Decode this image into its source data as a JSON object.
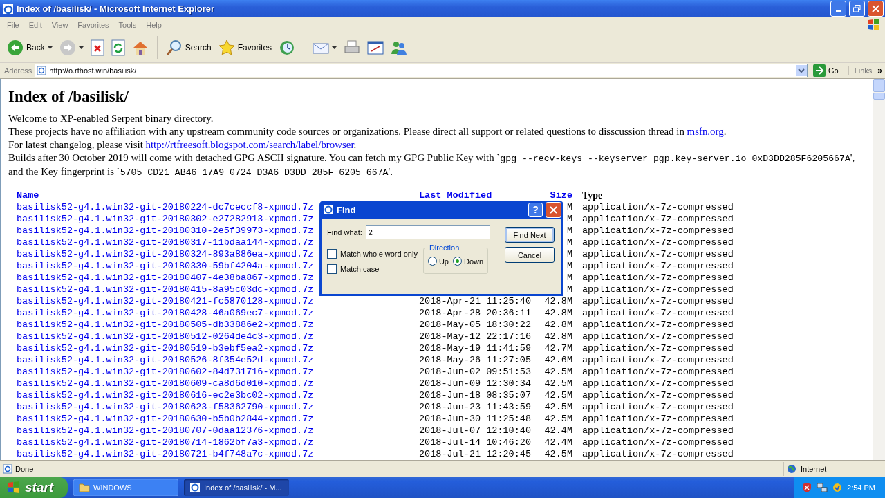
{
  "window": {
    "title": "Index of /basilisk/ - Microsoft Internet Explorer"
  },
  "menu": [
    "File",
    "Edit",
    "View",
    "Favorites",
    "Tools",
    "Help"
  ],
  "toolbar": [
    {
      "kind": "back",
      "label": "Back"
    },
    {
      "kind": "forward"
    },
    {
      "kind": "stop"
    },
    {
      "kind": "refresh"
    },
    {
      "kind": "home"
    },
    {
      "kind": "search",
      "label": "Search"
    },
    {
      "kind": "favorites",
      "label": "Favorites"
    },
    {
      "kind": "history"
    },
    {
      "kind": "mail"
    },
    {
      "kind": "print"
    },
    {
      "kind": "edit"
    },
    {
      "kind": "messenger"
    }
  ],
  "address": {
    "label": "Address",
    "value": "http://o.rthost.win/basilisk/",
    "go": "Go",
    "links": "Links",
    "more": "»"
  },
  "page": {
    "heading": "Index of /basilisk/",
    "paragraphs": [
      [
        {
          "kind": "text",
          "text": "Welcome to XP-enabled Serpent binary directory."
        }
      ],
      [
        {
          "kind": "text",
          "text": "These projects have no affiliation with any upstream community code sources or organizations. Please direct all support or related questions to disscussion thread in "
        },
        {
          "kind": "link",
          "text": "msfn.org"
        },
        {
          "kind": "text",
          "text": "."
        }
      ],
      [
        {
          "kind": "text",
          "text": "For latest changelog, please visit "
        },
        {
          "kind": "link",
          "text": "http://rtfreesoft.blogspot.com/search/label/browser"
        },
        {
          "kind": "text",
          "text": "."
        }
      ],
      [
        {
          "kind": "text",
          "text": "Builds after 30 October 2019 will come with detached GPG ASCII signature. You can fetch my GPG Public Key with `"
        },
        {
          "kind": "code",
          "text": "gpg --recv-keys --keyserver pgp.key-server.io 0xD3DD285F6205667A"
        },
        {
          "kind": "text",
          "text": "', and the Key fingerprint is `"
        },
        {
          "kind": "code",
          "text": "5705 CD21 AB46 17A9 0724 D3A6 D3DD 285F 6205 667A"
        },
        {
          "kind": "text",
          "text": "'."
        }
      ]
    ],
    "table": {
      "columns": [
        {
          "label": "Name",
          "kind": "link"
        },
        {
          "label": "Last Modified",
          "kind": "link"
        },
        {
          "label": "Size",
          "kind": "link"
        },
        {
          "label": "Type",
          "kind": "plain"
        }
      ],
      "rows": [
        {
          "name": "basilisk52-g4.1.win32-git-20180224-dc7ceccf8-xpmod.7z",
          "size": "M",
          "type": "application/x-7z-compressed"
        },
        {
          "name": "basilisk52-g4.1.win32-git-20180302-e27282913-xpmod.7z",
          "size": "M",
          "type": "application/x-7z-compressed"
        },
        {
          "name": "basilisk52-g4.1.win32-git-20180310-2e5f39973-xpmod.7z",
          "size": "M",
          "type": "application/x-7z-compressed"
        },
        {
          "name": "basilisk52-g4.1.win32-git-20180317-11bdaa144-xpmod.7z",
          "size": "M",
          "type": "application/x-7z-compressed"
        },
        {
          "name": "basilisk52-g4.1.win32-git-20180324-893a886ea-xpmod.7z",
          "size": "M",
          "type": "application/x-7z-compressed"
        },
        {
          "name": "basilisk52-g4.1.win32-git-20180330-59bf4204a-xpmod.7z",
          "size": "M",
          "type": "application/x-7z-compressed"
        },
        {
          "name": "basilisk52-g4.1.win32-git-20180407-4e38ba867-xpmod.7z",
          "size": "M",
          "type": "application/x-7z-compressed"
        },
        {
          "name": "basilisk52-g4.1.win32-git-20180415-8a95c03dc-xpmod.7z",
          "size": "M",
          "type": "application/x-7z-compressed"
        },
        {
          "name": "basilisk52-g4.1.win32-git-20180421-fc5870128-xpmod.7z",
          "modified": "2018-Apr-21 11:25:40",
          "size": "42.8M",
          "type": "application/x-7z-compressed"
        },
        {
          "name": "basilisk52-g4.1.win32-git-20180428-46a069ec7-xpmod.7z",
          "modified": "2018-Apr-28 20:36:11",
          "size": "42.8M",
          "type": "application/x-7z-compressed"
        },
        {
          "name": "basilisk52-g4.1.win32-git-20180505-db33886e2-xpmod.7z",
          "modified": "2018-May-05 18:30:22",
          "size": "42.8M",
          "type": "application/x-7z-compressed"
        },
        {
          "name": "basilisk52-g4.1.win32-git-20180512-0264de4c3-xpmod.7z",
          "modified": "2018-May-12 22:17:16",
          "size": "42.8M",
          "type": "application/x-7z-compressed"
        },
        {
          "name": "basilisk52-g4.1.win32-git-20180519-b3ebf5ea2-xpmod.7z",
          "modified": "2018-May-19 11:41:59",
          "size": "42.7M",
          "type": "application/x-7z-compressed"
        },
        {
          "name": "basilisk52-g4.1.win32-git-20180526-8f354e52d-xpmod.7z",
          "modified": "2018-May-26 11:27:05",
          "size": "42.6M",
          "type": "application/x-7z-compressed"
        },
        {
          "name": "basilisk52-g4.1.win32-git-20180602-84d731716-xpmod.7z",
          "modified": "2018-Jun-02 09:51:53",
          "size": "42.5M",
          "type": "application/x-7z-compressed"
        },
        {
          "name": "basilisk52-g4.1.win32-git-20180609-ca8d6d010-xpmod.7z",
          "modified": "2018-Jun-09 12:30:34",
          "size": "42.5M",
          "type": "application/x-7z-compressed"
        },
        {
          "name": "basilisk52-g4.1.win32-git-20180616-ec2e3bc02-xpmod.7z",
          "modified": "2018-Jun-18 08:35:07",
          "size": "42.5M",
          "type": "application/x-7z-compressed"
        },
        {
          "name": "basilisk52-g4.1.win32-git-20180623-f58362790-xpmod.7z",
          "modified": "2018-Jun-23 11:43:59",
          "size": "42.5M",
          "type": "application/x-7z-compressed"
        },
        {
          "name": "basilisk52-g4.1.win32-git-20180630-b5b0b2844-xpmod.7z",
          "modified": "2018-Jun-30 11:25:48",
          "size": "42.5M",
          "type": "application/x-7z-compressed"
        },
        {
          "name": "basilisk52-g4.1.win32-git-20180707-0daa12376-xpmod.7z",
          "modified": "2018-Jul-07 12:10:40",
          "size": "42.4M",
          "type": "application/x-7z-compressed"
        },
        {
          "name": "basilisk52-g4.1.win32-git-20180714-1862bf7a3-xpmod.7z",
          "modified": "2018-Jul-14 10:46:20",
          "size": "42.4M",
          "type": "application/x-7z-compressed"
        },
        {
          "name": "basilisk52-g4.1.win32-git-20180721-b4f748a7c-xpmod.7z",
          "modified": "2018-Jul-21 12:20:45",
          "size": "42.5M",
          "type": "application/x-7z-compressed"
        }
      ]
    }
  },
  "find_dialog": {
    "title": "Find",
    "help": "?",
    "find_label": "Find what:",
    "value": "2",
    "options": [
      {
        "label": "Match whole word only",
        "checked": false
      },
      {
        "label": "Match case",
        "checked": false
      }
    ],
    "direction": {
      "label": "Direction",
      "options": [
        {
          "label": "Up",
          "selected": false
        },
        {
          "label": "Down",
          "selected": true
        }
      ]
    },
    "buttons": [
      {
        "label": "Find Next",
        "default": true
      },
      {
        "label": "Cancel",
        "default": false
      }
    ]
  },
  "status_bar": {
    "text": "Done",
    "zone": "Internet"
  },
  "taskbar": {
    "start": "start",
    "tasks": [
      {
        "label": "WINDOWS",
        "kind": "folder",
        "selected": false
      },
      {
        "label": "Index of /basilisk/ - M...",
        "kind": "browser",
        "selected": true
      }
    ],
    "clock": "2:54 PM"
  }
}
